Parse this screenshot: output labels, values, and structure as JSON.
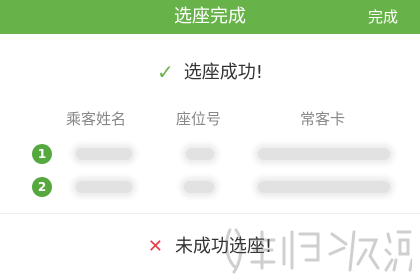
{
  "header": {
    "title": "选座完成",
    "done_label": "完成",
    "bg_color": "#67b34a"
  },
  "result": {
    "success_icon": "check-icon",
    "success_text": "选座成功!",
    "fail_icon": "cross-icon",
    "fail_text": "未成功选座!"
  },
  "table": {
    "columns": [
      "乘客姓名",
      "座位号",
      "常客卡"
    ],
    "rows": [
      {
        "index": "1"
      },
      {
        "index": "2"
      }
    ]
  }
}
